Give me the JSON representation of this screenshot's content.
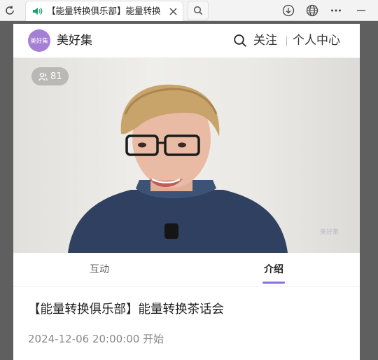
{
  "browser": {
    "tab_title": "【能量转换俱乐部】能量转换",
    "tab_icon": "speaker-icon",
    "tools": [
      "download-icon",
      "globe-icon",
      "more-icon",
      "minimize-icon"
    ]
  },
  "header": {
    "logo_text": "美好集",
    "brand_name": "美好集",
    "follow_label": "关注",
    "user_center_label": "个人中心"
  },
  "video": {
    "viewer_count": "81",
    "watermark": "美好集"
  },
  "tabs": [
    {
      "label": "互动",
      "active": false
    },
    {
      "label": "介绍",
      "active": true
    }
  ],
  "event": {
    "title": "【能量转换俱乐部】能量转换茶话会",
    "time_text": "2024-12-06 20:00:00 开始"
  },
  "colors": {
    "accent": "#8f6fe0",
    "logo_bg": "#a47fd4",
    "speaker": "#1aa36b"
  }
}
